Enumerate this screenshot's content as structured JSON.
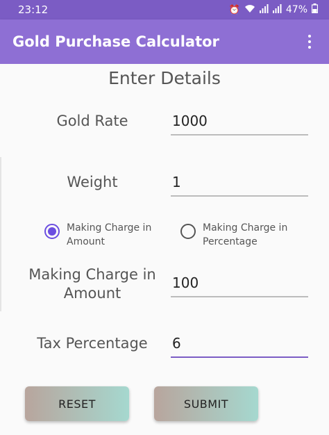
{
  "status_bar": {
    "time": "23:12",
    "battery": "47%",
    "icons": [
      "alarm-icon",
      "wifi-icon",
      "signal-icon",
      "signal-icon",
      "battery-icon"
    ]
  },
  "app_bar": {
    "title": "Gold Purchase Calculator"
  },
  "form": {
    "heading": "Enter Details",
    "gold_rate": {
      "label": "Gold Rate",
      "value": "1000"
    },
    "weight": {
      "label": "Weight",
      "value": "1"
    },
    "radio_amount": {
      "label": "Making Charge in Amount",
      "checked": true
    },
    "radio_percentage": {
      "label": "Making Charge in Percentage",
      "checked": false
    },
    "making_charge": {
      "label": "Making Charge in Amount",
      "value": "100"
    },
    "tax": {
      "label": "Tax Percentage",
      "value": "6"
    }
  },
  "buttons": {
    "reset": "RESET",
    "submit": "SUBMIT"
  },
  "colors": {
    "status_bar": "#7b5cc4",
    "app_bar": "#8e6fd4",
    "accent": "#6b4ee0"
  }
}
